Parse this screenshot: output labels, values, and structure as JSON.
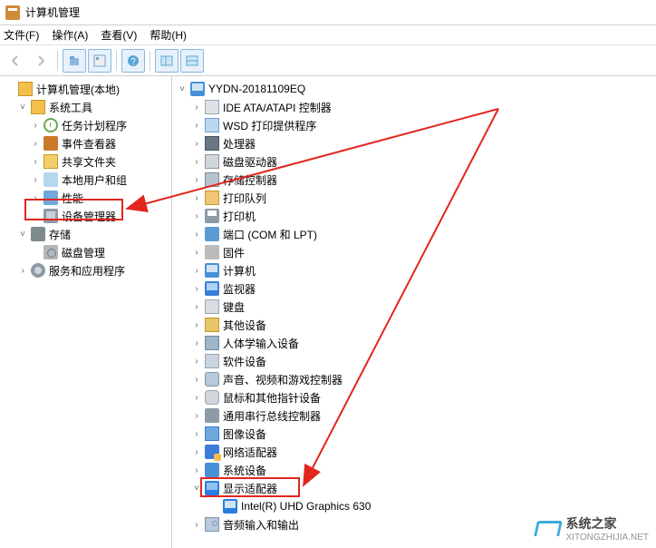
{
  "window": {
    "title": "计算机管理"
  },
  "menu": {
    "file": "文件(F)",
    "action": "操作(A)",
    "view": "查看(V)",
    "help": "帮助(H)"
  },
  "toolbar_icons": {
    "back": "back-icon",
    "forward": "forward-icon",
    "up": "up-icon",
    "show": "show-pane-icon",
    "props": "properties-icon",
    "refresh": "refresh-icon",
    "export": "export-icon"
  },
  "left_tree": {
    "root": "计算机管理(本地)",
    "system_tools": "系统工具",
    "task_scheduler": "任务计划程序",
    "event_viewer": "事件查看器",
    "shared_folders": "共享文件夹",
    "local_users": "本地用户和组",
    "performance": "性能",
    "device_manager": "设备管理器",
    "storage": "存储",
    "disk_mgmt": "磁盘管理",
    "services_apps": "服务和应用程序"
  },
  "right_tree": {
    "root": "YYDN-20181109EQ",
    "ide_ata": "IDE ATA/ATAPI 控制器",
    "wsd": "WSD 打印提供程序",
    "cpu": "处理器",
    "disk_drives": "磁盘驱动器",
    "storage_ctrl": "存储控制器",
    "print_queue": "打印队列",
    "printers": "打印机",
    "ports": "端口 (COM 和 LPT)",
    "firmware": "固件",
    "computer": "计算机",
    "monitor": "监视器",
    "keyboard": "键盘",
    "other": "其他设备",
    "hid": "人体学输入设备",
    "software": "软件设备",
    "sound": "声音、视频和游戏控制器",
    "mouse": "鼠标和其他指针设备",
    "usb": "通用串行总线控制器",
    "imaging": "图像设备",
    "network": "网络适配器",
    "system_dev": "系统设备",
    "display": "显示适配器",
    "gpu": "Intel(R) UHD Graphics 630",
    "audio": "音频输入和输出"
  },
  "watermark": {
    "brand": "系统之家",
    "url": "XITONGZHIJIA.NET"
  }
}
